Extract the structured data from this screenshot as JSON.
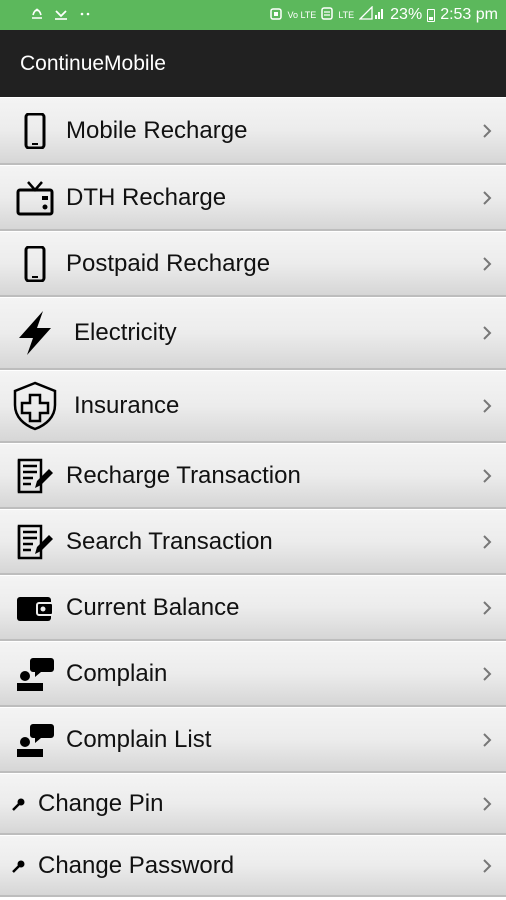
{
  "status_bar": {
    "left_icons": [
      "notification-icon",
      "missed-call-icon",
      "more-icon"
    ],
    "volte_label": "Vo LTE",
    "lte_label": "LTE",
    "battery_percent": "23%",
    "time": "2:53 pm"
  },
  "app_bar": {
    "title": "ContinueMobile"
  },
  "menu": {
    "items": [
      {
        "label": "Mobile Recharge",
        "icon": "mobile-phone-icon"
      },
      {
        "label": "DTH Recharge",
        "icon": "tv-icon"
      },
      {
        "label": "Postpaid Recharge",
        "icon": "mobile-phone-icon"
      },
      {
        "label": "Electricity",
        "icon": "lightning-bolt-icon"
      },
      {
        "label": "Insurance",
        "icon": "shield-plus-icon"
      },
      {
        "label": "Recharge Transaction",
        "icon": "transaction-list-icon"
      },
      {
        "label": "Search Transaction",
        "icon": "transaction-list-icon"
      },
      {
        "label": "Current Balance",
        "icon": "wallet-icon"
      },
      {
        "label": "Complain",
        "icon": "complain-chat-icon"
      },
      {
        "label": "Complain List",
        "icon": "complain-chat-icon"
      },
      {
        "label": "Change Pin",
        "icon": "key-icon"
      },
      {
        "label": "Change Password",
        "icon": "key-icon"
      }
    ]
  },
  "colors": {
    "status_bar": "#5cb85c",
    "app_bar": "#212121",
    "menu_item_bg": "#ececec"
  }
}
